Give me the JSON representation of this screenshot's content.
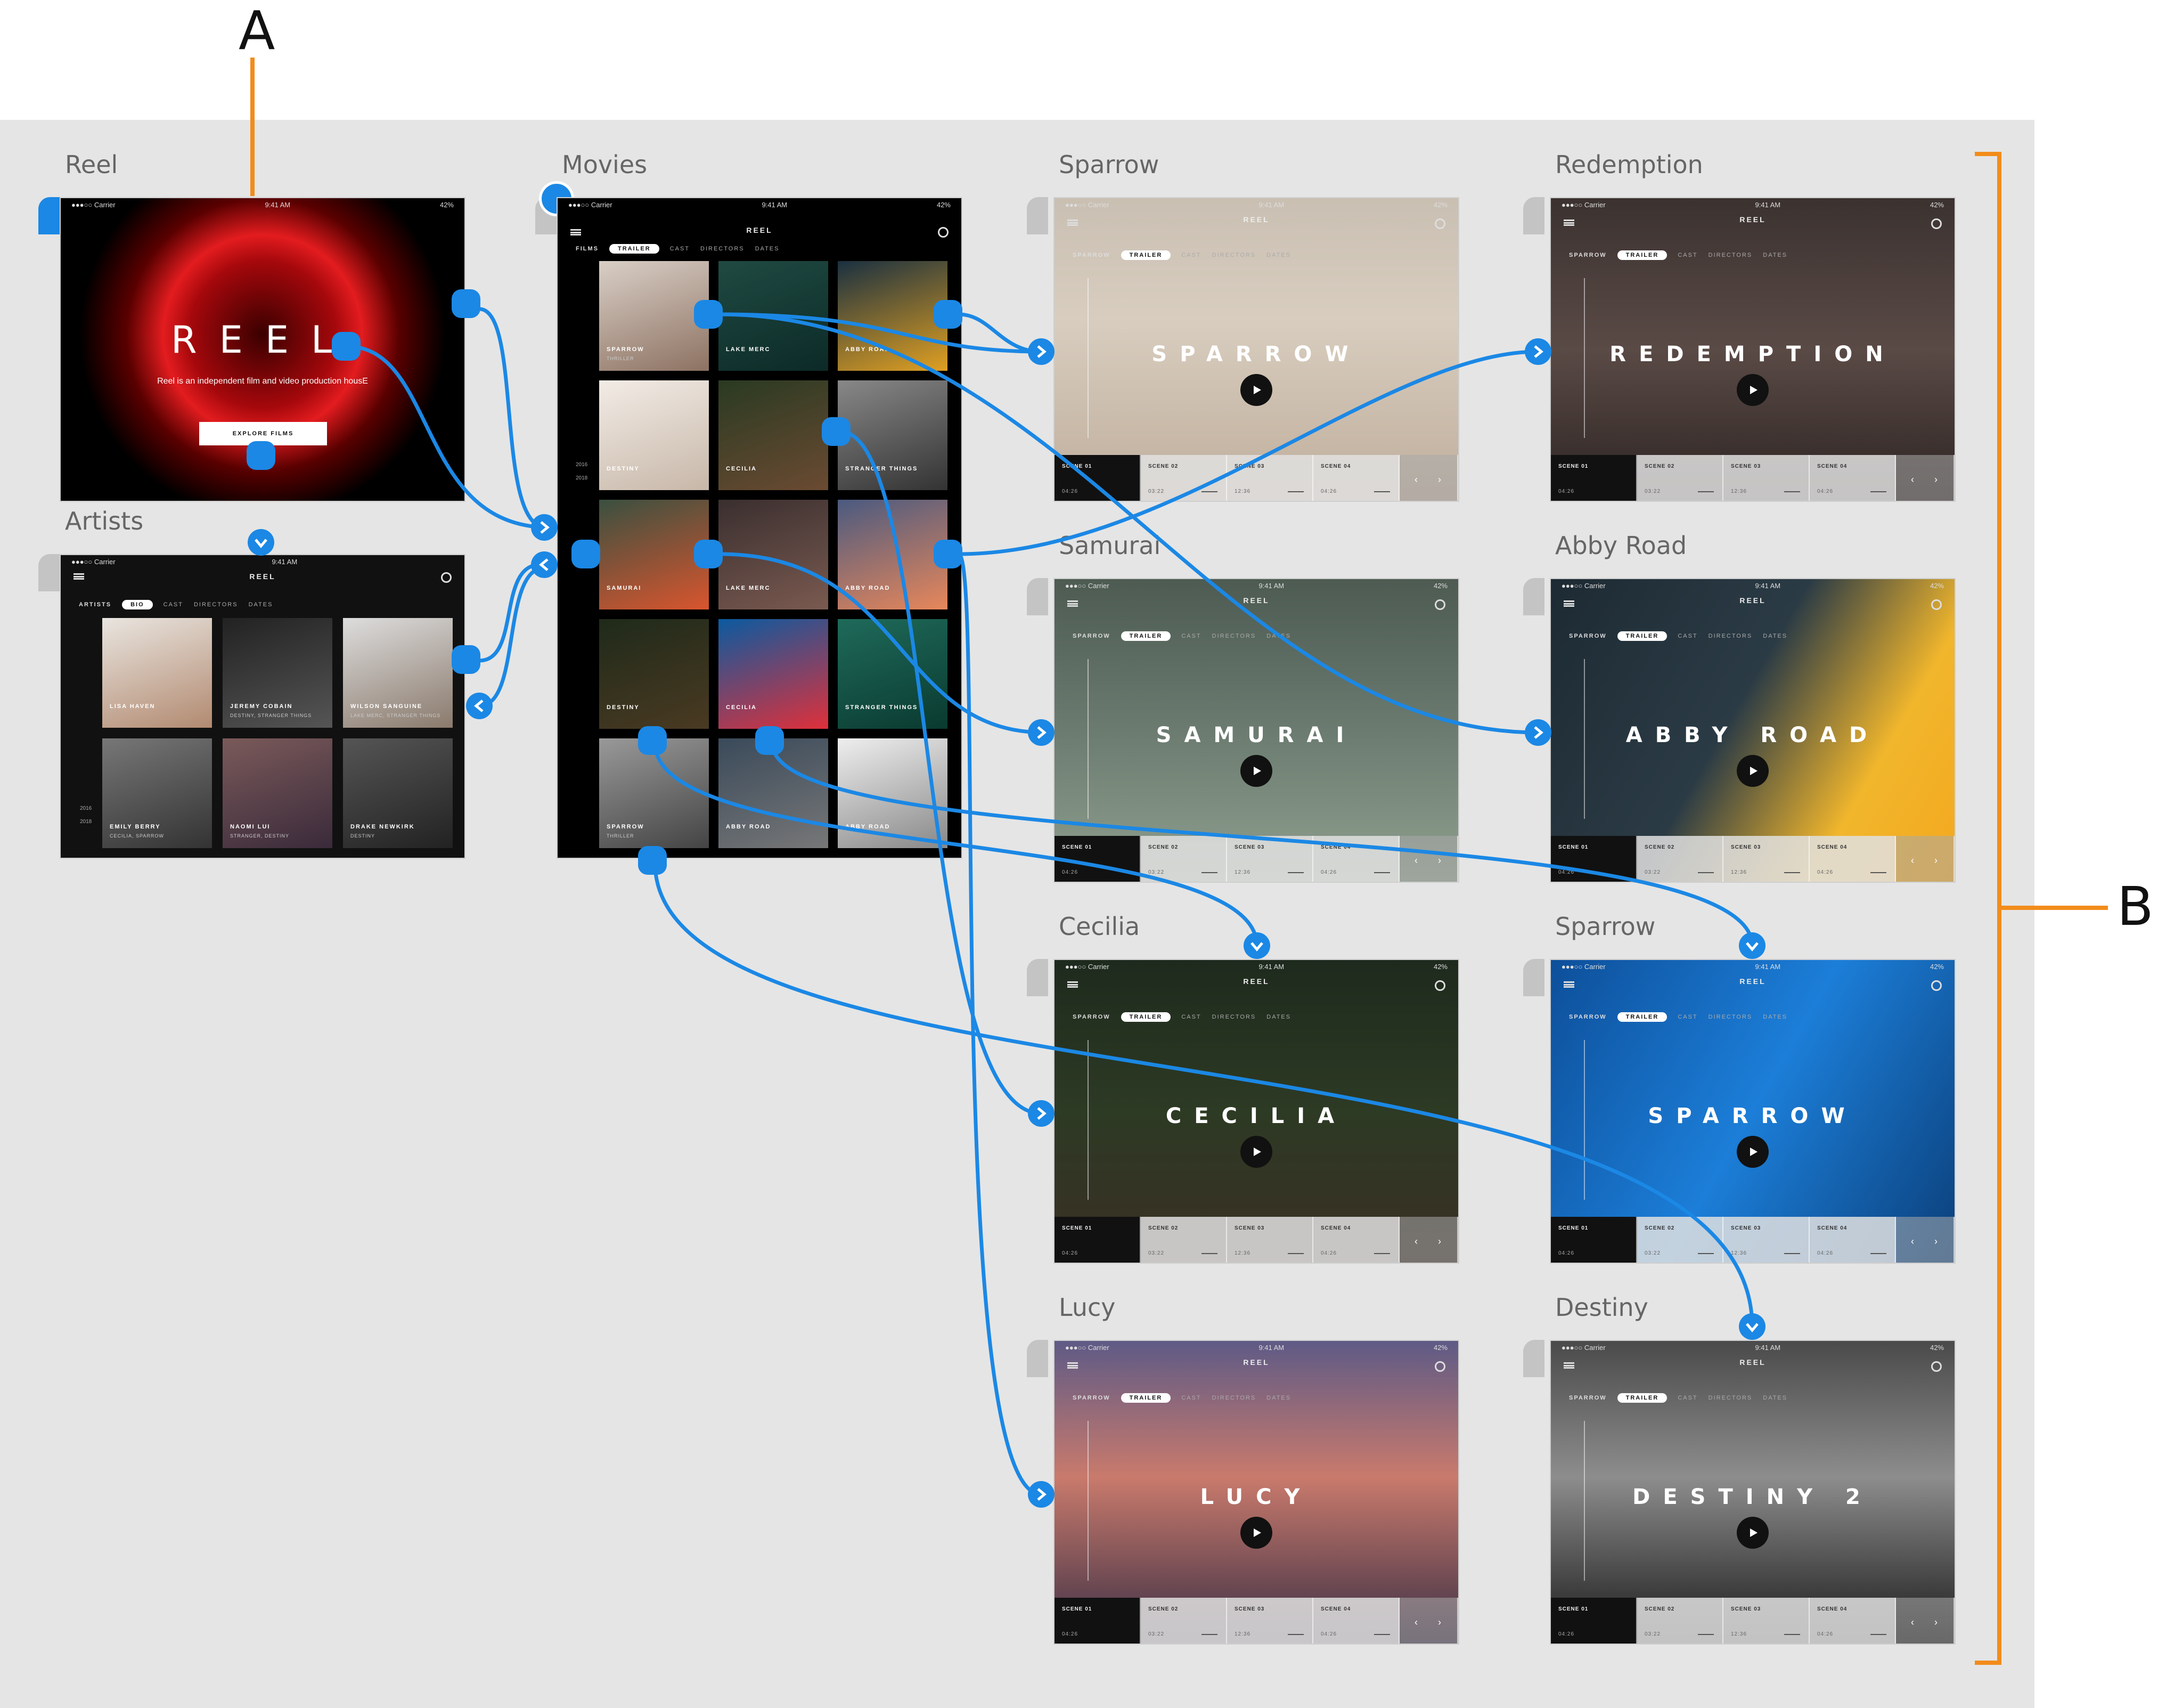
{
  "callouts": {
    "a": "A",
    "b": "B"
  },
  "colors": {
    "wire": "#1b88e5",
    "callout": "#f28c1b",
    "canvas": "#e5e5e5"
  },
  "boards": {
    "reel": {
      "label": "Reel",
      "status_left": "●●●○○ Carrier",
      "status_time": "9:41 AM",
      "status_right": "42%",
      "title": "REEL",
      "tagline": "Reel is an independent film and video production housE",
      "cta": "EXPLORE FILMS"
    },
    "artists": {
      "label": "Artists",
      "status_left": "●●●○○ Carrier",
      "status_time": "9:41 AM",
      "app_title": "REEL",
      "section": "ARTISTS",
      "tabs": [
        "BIO",
        "CAST",
        "DIRECTORS",
        "DATES"
      ],
      "years": [
        "2016",
        "2018"
      ],
      "people": [
        {
          "name": "LISA HAVEN",
          "role": ""
        },
        {
          "name": "JEREMY COBAIN",
          "role": "DESTINY, STRANGER THINGS"
        },
        {
          "name": "WILSON SANGUINE",
          "role": "LAKE MERC, STRANGER THINGS"
        },
        {
          "name": "EMILY BERRY",
          "role": "CECILIA, SPARROW"
        },
        {
          "name": "NAOMI LUI",
          "role": "STRANGER, DESTINY"
        },
        {
          "name": "DRAKE NEWKIRK",
          "role": "DESTINY"
        }
      ]
    },
    "movies": {
      "label": "Movies",
      "status_left": "●●●○○ Carrier",
      "status_time": "9:41 AM",
      "status_right": "42%",
      "app_title": "REEL",
      "section": "FILMS",
      "tabs": [
        "TRAILER",
        "CAST",
        "DIRECTORS",
        "DATES"
      ],
      "years": [
        "2016",
        "2018"
      ],
      "films": [
        {
          "title": "SPARROW",
          "sub": "THRILLER"
        },
        {
          "title": "LAKE MERC",
          "sub": ""
        },
        {
          "title": "ABBY ROAD",
          "sub": ""
        },
        {
          "title": "DESTINY",
          "sub": ""
        },
        {
          "title": "CECILIA",
          "sub": ""
        },
        {
          "title": "STRANGER THINGS",
          "sub": ""
        },
        {
          "title": "SAMURAI",
          "sub": ""
        },
        {
          "title": "LAKE MERC",
          "sub": ""
        },
        {
          "title": "ABBY ROAD",
          "sub": ""
        },
        {
          "title": "DESTINY",
          "sub": ""
        },
        {
          "title": "CECILIA",
          "sub": ""
        },
        {
          "title": "STRANGER THINGS",
          "sub": ""
        },
        {
          "title": "SPARROW",
          "sub": "THRILLER"
        },
        {
          "title": "ABBY ROAD",
          "sub": ""
        },
        {
          "title": "ABBY ROAD",
          "sub": ""
        }
      ]
    },
    "films": [
      {
        "label": "Sparrow",
        "title": "SPARROW",
        "bg": "linear-gradient(180deg,#c9bfb2 0%,#d8cdbf 40%,#bfae9c 100%)"
      },
      {
        "label": "Redemption",
        "title": "REDEMPTION",
        "bg": "linear-gradient(180deg,#3b3230 0%,#5a4a46 50%,#2c2422 100%)"
      },
      {
        "label": "Samurai",
        "title": "SAMURAI",
        "bg": "linear-gradient(180deg,#4d5b52 0%,#6b7b70 50%,#8fa08f 100%)"
      },
      {
        "label": "Abby Road",
        "title": "ABBY ROAD",
        "bg": "linear-gradient(120deg,#1d2a33 0%,#2b3b45 45%,#f1b62c 75%,#f4a81f 100%)"
      },
      {
        "label": "Cecilia",
        "title": "CECILIA",
        "bg": "linear-gradient(180deg,#1e2a1d 0%,#2d3a24 50%,#3a2e24 100%)"
      },
      {
        "label": "Sparrow",
        "title": "SPARROW",
        "bg": "linear-gradient(120deg,#0d4f9a 0%,#1c7ed8 50%,#0b3f7a 100%)"
      },
      {
        "label": "Lucy",
        "title": "LUCY",
        "bg": "linear-gradient(180deg,#5e5a86 0%,#c97a6c 45%,#3b2f45 100%)"
      },
      {
        "label": "Destiny",
        "title": "DESTINY 2",
        "bg": "linear-gradient(180deg,#4a4a4a 0%,#8d8d8d 45%,#1a1a1a 100%)"
      }
    ],
    "film_ui": {
      "status_left": "●●●○○ Carrier",
      "status_time": "9:41 AM",
      "status_right": "42%",
      "app_title": "REEL",
      "subnav": [
        "SPARROW",
        "TRAILER",
        "CAST",
        "DIRECTORS",
        "DATES"
      ],
      "scenes": [
        {
          "label": "SCENE 01",
          "time": "04:26"
        },
        {
          "label": "SCENE 02",
          "time": "03:22"
        },
        {
          "label": "SCENE 03",
          "time": "12:36"
        },
        {
          "label": "SCENE 04",
          "time": "04:26"
        }
      ],
      "nav_prev": "‹",
      "nav_next": "›"
    }
  }
}
